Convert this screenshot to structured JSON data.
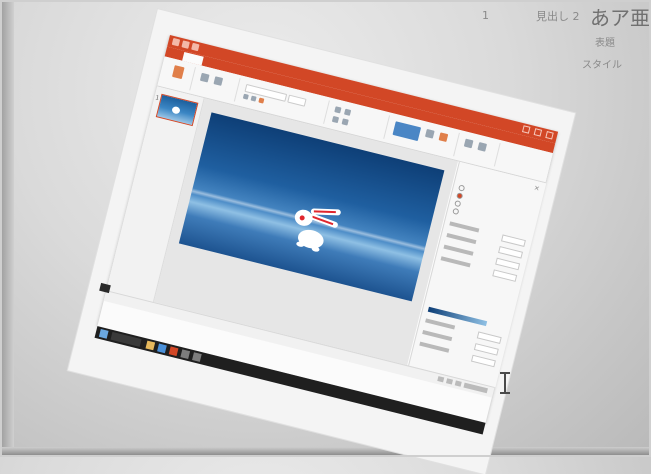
{
  "background_app": {
    "ribbon_texts": [
      "1",
      "見出し 2",
      "あア亜",
      "表題",
      "スタイル"
    ]
  },
  "powerpoint": {
    "title": "",
    "tabs": [],
    "ribbon_groups": 9,
    "format_pane_title": "",
    "status_text": "",
    "taskbar_time": ""
  },
  "colors": {
    "accent": "#d24726",
    "slide_top": "#0e3f77",
    "slide_mid": "#4c8cc7",
    "eye_red": "#e0262e"
  },
  "icons": {
    "cursor": "text-cursor-icon",
    "app_logo": "powerpoint-icon"
  }
}
